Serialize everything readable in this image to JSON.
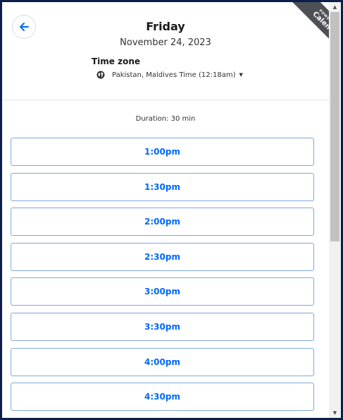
{
  "header": {
    "day": "Friday",
    "date": "November 24, 2023",
    "timezone_label": "Time zone",
    "timezone_value": "Pakistan, Maldives Time (12:18am)"
  },
  "branding": {
    "powered_by": "POWERED BY",
    "brand": "Calendly"
  },
  "duration": "Duration: 30 min",
  "slots": [
    "1:00pm",
    "1:30pm",
    "2:00pm",
    "2:30pm",
    "3:00pm",
    "3:30pm",
    "4:00pm",
    "4:30pm"
  ],
  "colors": {
    "accent": "#0069ff",
    "slot_border": "#7fa8dc",
    "ribbon": "#4d5055",
    "window_frame": "#0b1f4a"
  }
}
